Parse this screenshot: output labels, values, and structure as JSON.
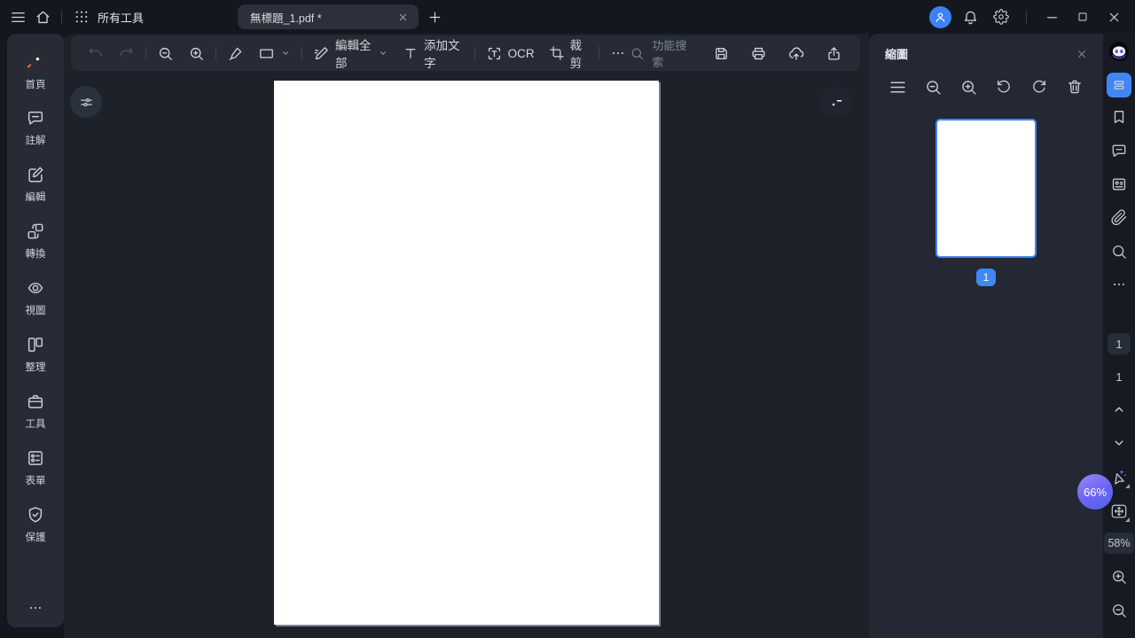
{
  "titlebar": {
    "all_tools": "所有工具",
    "tab_title": "無標題_1.pdf *"
  },
  "toolbar": {
    "edit_all": "編輯全部",
    "add_text": "添加文字",
    "ocr": "OCR",
    "crop": "裁剪",
    "search_placeholder": "功能搜索"
  },
  "sidebar": {
    "items": [
      {
        "label": "首頁",
        "icon": "rocket-icon"
      },
      {
        "label": "註解",
        "icon": "comment-icon"
      },
      {
        "label": "編輯",
        "icon": "edit-square-icon"
      },
      {
        "label": "轉換",
        "icon": "convert-icon"
      },
      {
        "label": "視圖",
        "icon": "eye-icon"
      },
      {
        "label": "整理",
        "icon": "organize-pages-icon"
      },
      {
        "label": "工具",
        "icon": "briefcase-icon"
      },
      {
        "label": "表單",
        "icon": "form-icon"
      },
      {
        "label": "保護",
        "icon": "shield-check-icon"
      }
    ],
    "more_icon": "ellipsis-icon"
  },
  "thumb_panel": {
    "title": "縮圖",
    "page_badge": "1",
    "tool_icons": [
      "menu-icon",
      "zoom-out-icon",
      "zoom-in-icon",
      "rotate-left-icon",
      "rotate-right-icon",
      "trash-icon"
    ]
  },
  "rail": {
    "current_page": "1",
    "total_pages": "1",
    "ai_zoom_badge": "66%",
    "zoom_level": "58%",
    "icons": [
      "ai-robot-icon",
      "thumbnail-panel-icon",
      "bookmark-icon",
      "comment-icon",
      "form-card-icon",
      "paperclip-icon",
      "search-icon",
      "ellipsis-icon",
      "chevron-up-icon",
      "chevron-down-icon",
      "ai-cursor-icon",
      "pan-tool-icon",
      "zoom-in-icon",
      "zoom-out-icon"
    ]
  },
  "titlebar_icons": [
    "menu-icon",
    "home-icon",
    "grid-icon",
    "close-icon",
    "plus-icon",
    "user-avatar-icon",
    "bell-icon",
    "gear-icon",
    "minimize-icon",
    "maximize-icon",
    "close-window-icon"
  ],
  "toolbar_icons": [
    "undo-icon",
    "redo-icon",
    "zoom-out-icon",
    "zoom-in-icon",
    "highlighter-icon",
    "rectangle-shape-icon",
    "chevron-down-icon",
    "edit-pen-icon",
    "text-icon",
    "ocr-icon",
    "crop-icon",
    "ellipsis-icon",
    "search-icon",
    "save-icon",
    "print-icon",
    "cloud-upload-icon",
    "share-icon",
    "sliders-icon",
    "ai-folder-icon"
  ],
  "colors": {
    "accent_blue": "#3f87f5",
    "panel_bg": "#262b35",
    "canvas_bg": "#1d212a",
    "titlebar_bg": "#14171e",
    "thumb_panel_bg": "#232834",
    "rail_bg": "#171a22",
    "badge_gradient": [
      "#988af8",
      "#4d66ee"
    ],
    "rocket_red": "#e8384e",
    "folder_purple": "#8b5cf6"
  }
}
